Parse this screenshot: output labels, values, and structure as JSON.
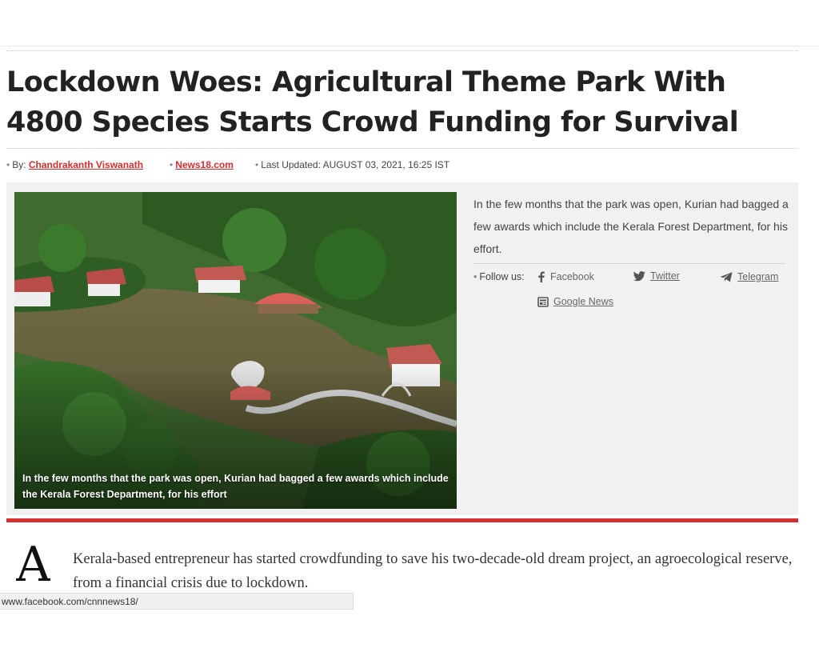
{
  "article": {
    "headline": "Lockdown Woes: Agricultural Theme Park With 4800 Species Starts Crowd Funding for Survival",
    "byline": {
      "by_label": "By:",
      "author": "Chandrakanth Viswanath",
      "source": "News18.com",
      "updated_label": "Last Updated: AUGUST 03, 2021, 16:25 IST"
    },
    "photo_caption": "In the few months that the park was open, Kurian had bagged a few awards which include the Kerala Forest Department, for his effort",
    "side_summary": "In the few months that the park was open, Kurian had bagged a few awards which include the Kerala Forest Department, for his effort.",
    "lead_dropcap": "A",
    "lead_text": "Kerala-based entrepreneur has started crowdfunding to save his two-decade-old dream project, an agroecological reserve, from a financial crisis due to lockdown."
  },
  "follow": {
    "label": "Follow us:",
    "facebook": "Facebook",
    "twitter": "Twitter",
    "telegram": "Telegram",
    "google_news": "Google News"
  },
  "icons": [
    "facebook-icon",
    "twitter-icon",
    "telegram-icon",
    "google-news-icon"
  ],
  "colors": {
    "accent": "#d32f2f",
    "feature_bg": "#f1f1f1"
  },
  "status_bar": {
    "url": "www.facebook.com/cnnnews18/"
  }
}
